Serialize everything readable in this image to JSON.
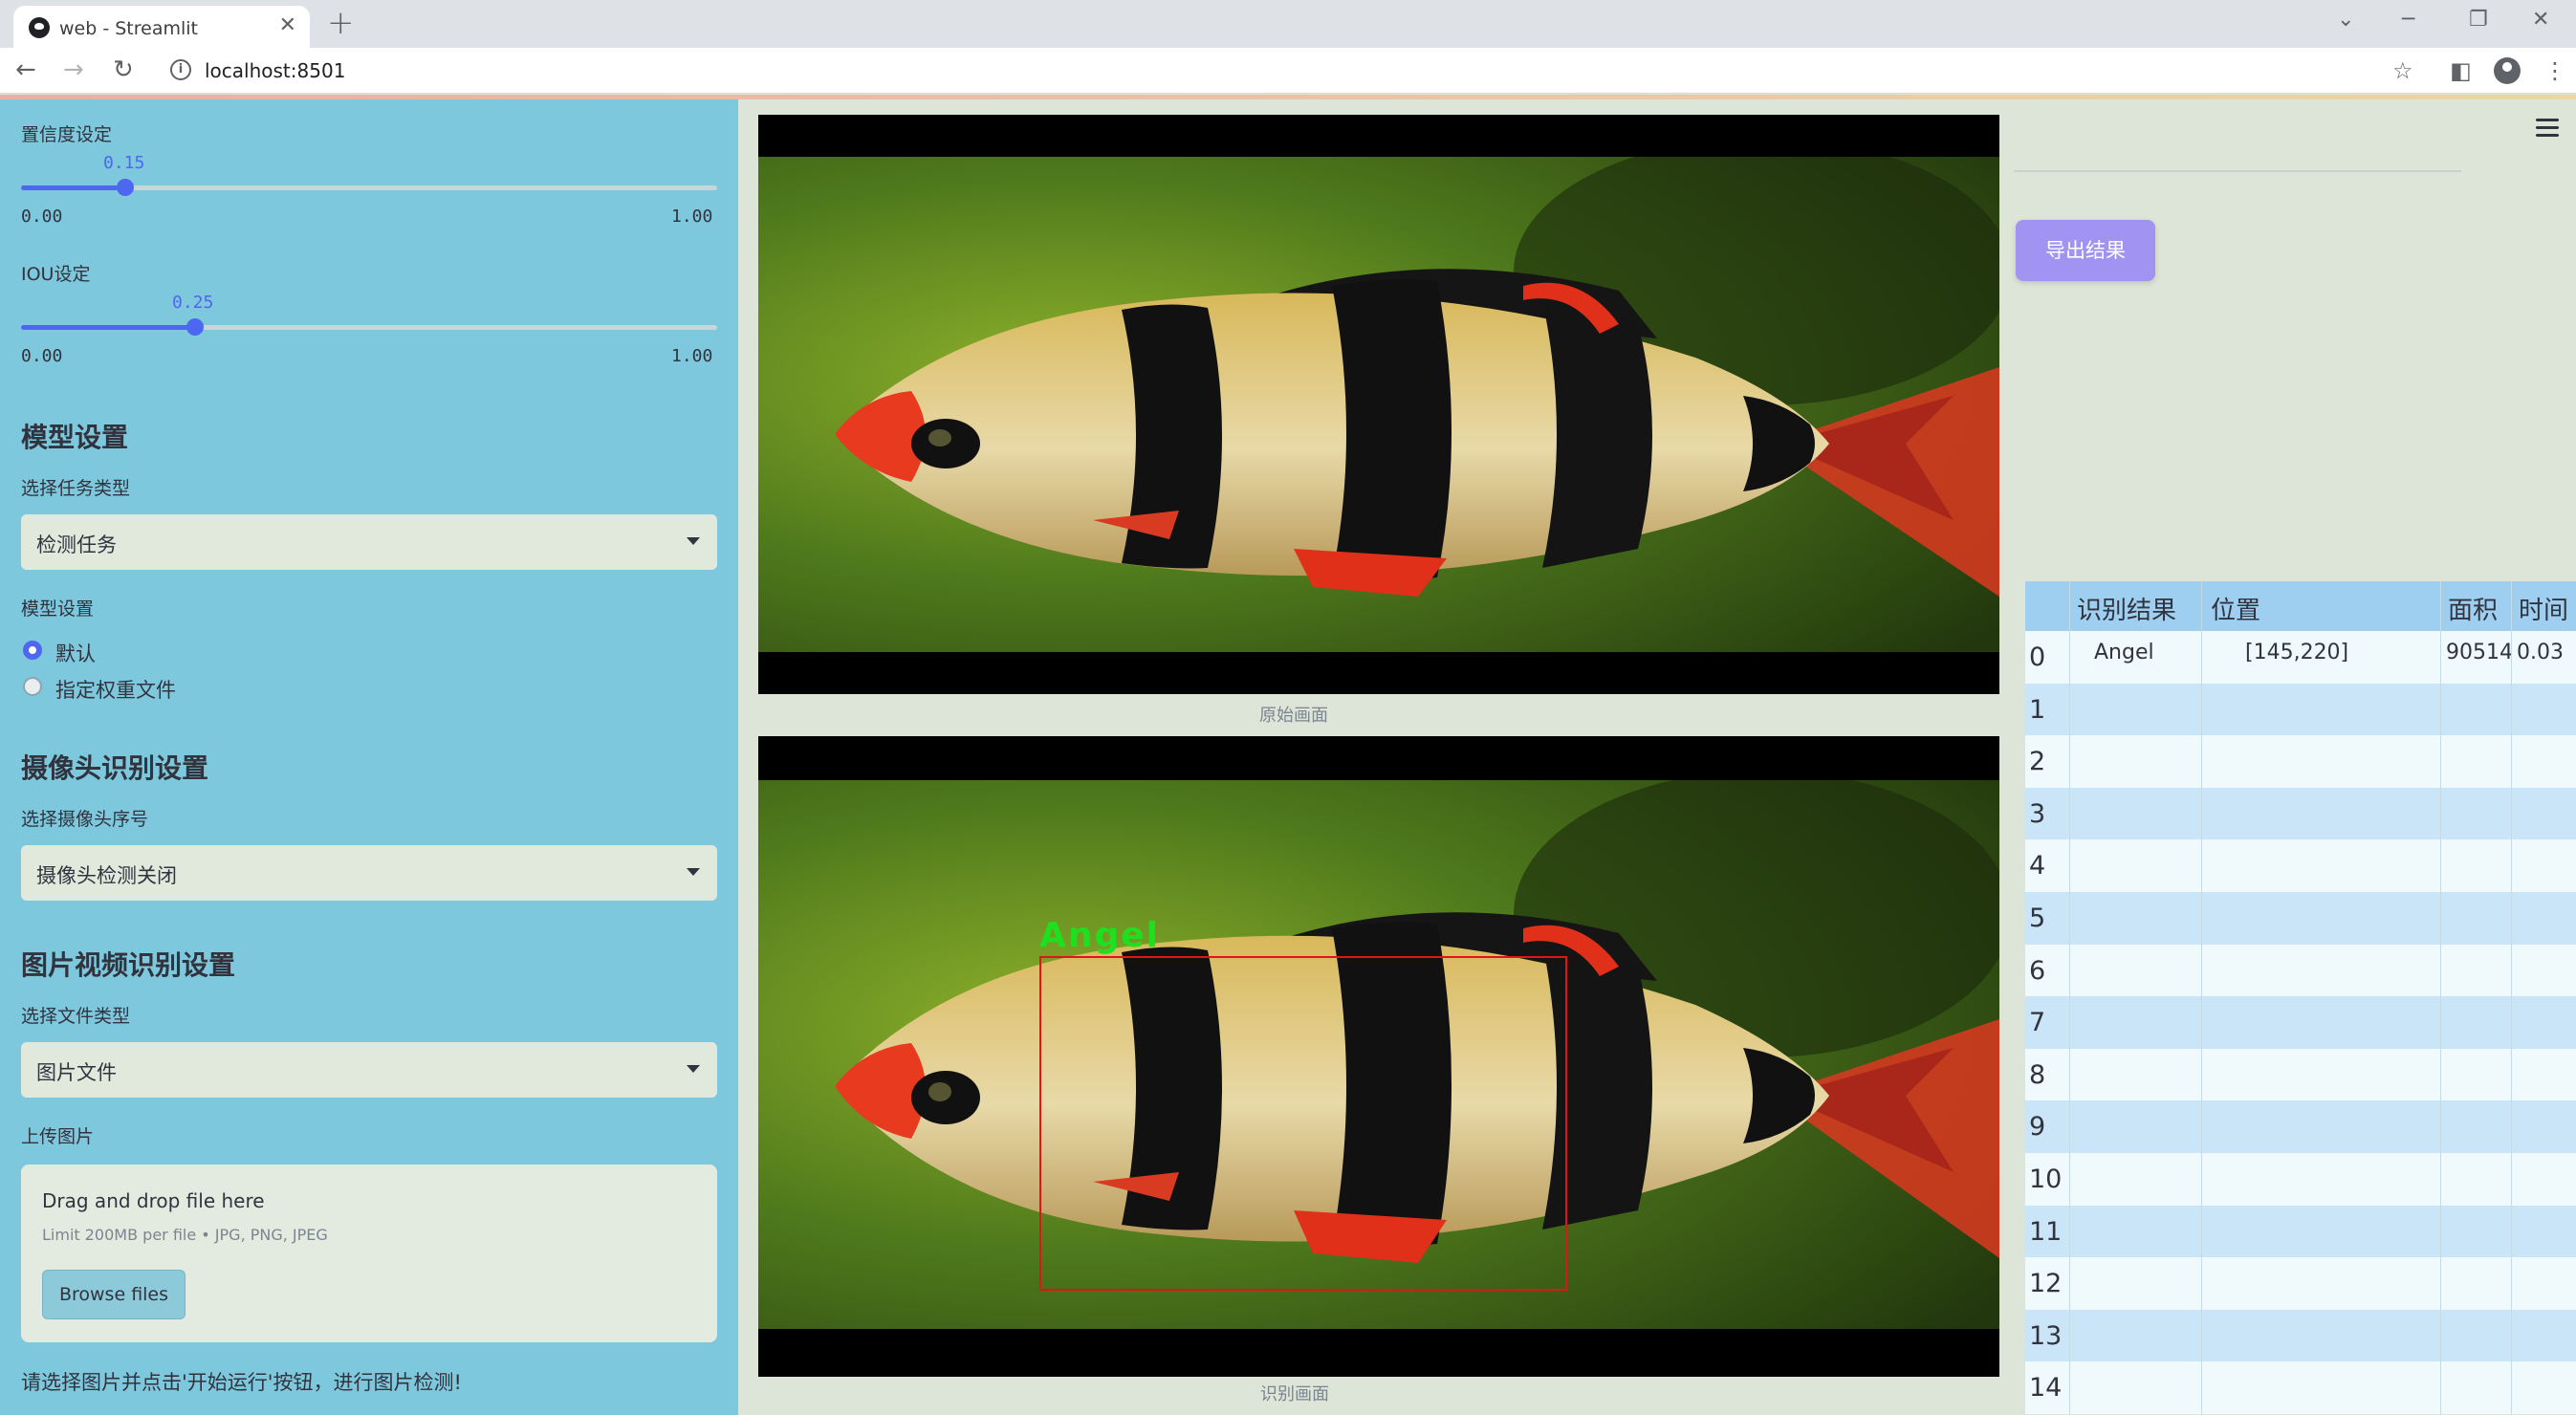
{
  "browser": {
    "tab_title": "web - Streamlit",
    "url": "localhost:8501"
  },
  "sidebar": {
    "confidence": {
      "label": "置信度设定",
      "value": "0.15",
      "min": "0.00",
      "max": "1.00",
      "fraction": 0.15
    },
    "iou": {
      "label": "IOU设定",
      "value": "0.25",
      "min": "0.00",
      "max": "1.00",
      "fraction": 0.25
    },
    "model_section": {
      "heading": "模型设置",
      "task_label": "选择任务类型",
      "task_value": "检测任务",
      "model_label": "模型设置",
      "options": [
        "默认",
        "指定权重文件"
      ],
      "selected_option": "默认"
    },
    "camera_section": {
      "heading": "摄像头识别设置",
      "camera_label": "选择摄像头序号",
      "camera_value": "摄像头检测关闭"
    },
    "file_section": {
      "heading": "图片视频识别设置",
      "type_label": "选择文件类型",
      "type_value": "图片文件",
      "upload_label": "上传图片",
      "dropzone_title": "Drag and drop file here",
      "dropzone_limit": "Limit 200MB per file • JPG, PNG, JPEG",
      "browse_label": "Browse files"
    },
    "hint": "请选择图片并点击'开始运行'按钮，进行图片检测!"
  },
  "main": {
    "original_caption": "原始画面",
    "detected_caption": "识别画面",
    "detection_label": "Angel"
  },
  "right_panel": {
    "export_label": "导出结果",
    "table": {
      "columns": [
        "识别结果",
        "位置",
        "面积",
        "时间"
      ],
      "rows": [
        {
          "index": "0",
          "result": "Angel",
          "position": "[145,220]",
          "area": "90514",
          "time": "0.03"
        },
        {
          "index": "1",
          "result": "",
          "position": "",
          "area": "",
          "time": ""
        },
        {
          "index": "2",
          "result": "",
          "position": "",
          "area": "",
          "time": ""
        },
        {
          "index": "3",
          "result": "",
          "position": "",
          "area": "",
          "time": ""
        },
        {
          "index": "4",
          "result": "",
          "position": "",
          "area": "",
          "time": ""
        },
        {
          "index": "5",
          "result": "",
          "position": "",
          "area": "",
          "time": ""
        },
        {
          "index": "6",
          "result": "",
          "position": "",
          "area": "",
          "time": ""
        },
        {
          "index": "7",
          "result": "",
          "position": "",
          "area": "",
          "time": ""
        },
        {
          "index": "8",
          "result": "",
          "position": "",
          "area": "",
          "time": ""
        },
        {
          "index": "9",
          "result": "",
          "position": "",
          "area": "",
          "time": ""
        },
        {
          "index": "10",
          "result": "",
          "position": "",
          "area": "",
          "time": ""
        },
        {
          "index": "11",
          "result": "",
          "position": "",
          "area": "",
          "time": ""
        },
        {
          "index": "12",
          "result": "",
          "position": "",
          "area": "",
          "time": ""
        },
        {
          "index": "13",
          "result": "",
          "position": "",
          "area": "",
          "time": ""
        },
        {
          "index": "14",
          "result": "",
          "position": "",
          "area": "",
          "time": ""
        }
      ]
    }
  },
  "colors": {
    "sidebar_bg": "#7ec8dd",
    "main_bg": "#dde5d8",
    "accent": "#4e67f0",
    "export_button": "#a193f1",
    "table_header": "#9ecff0",
    "detection_box": "#e01515",
    "detection_text": "#1fe01f"
  }
}
